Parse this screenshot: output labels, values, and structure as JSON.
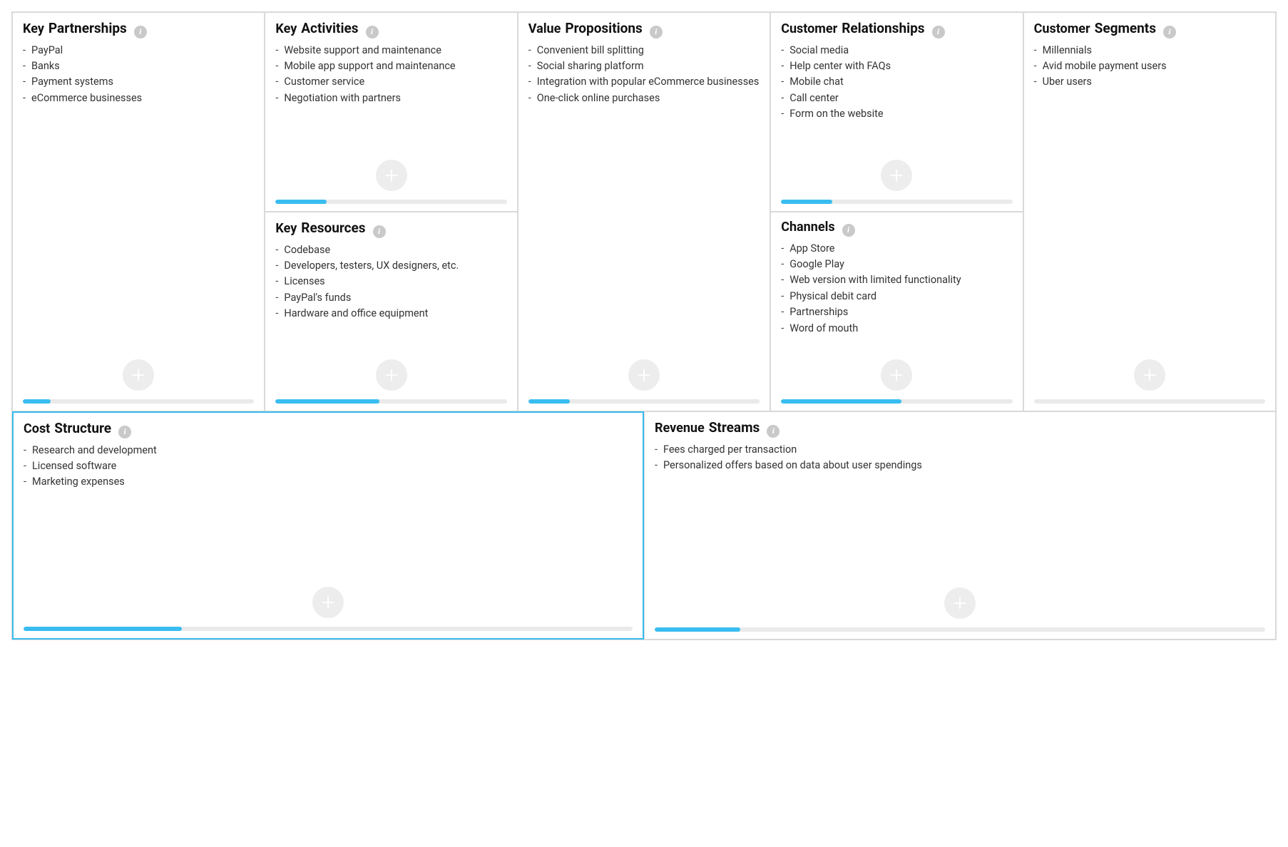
{
  "blocks": {
    "kp": {
      "title_a": "Key",
      "title_b": "Partnerships",
      "items": [
        "PayPal",
        "Banks",
        "Payment systems",
        "eCommerce businesses"
      ],
      "progress": 12,
      "selected": false
    },
    "ka": {
      "title_a": "Key",
      "title_b": "Activities",
      "items": [
        "Website support and maintenance",
        "Mobile app support and maintenance",
        "Customer service",
        "Negotiation with partners"
      ],
      "progress": 22,
      "selected": false
    },
    "kr": {
      "title_a": "Key",
      "title_b": "Resources",
      "items": [
        "Codebase",
        "Developers, testers, UX designers, etc.",
        "Licenses",
        "PayPal's funds",
        "Hardware and office equipment"
      ],
      "progress": 45,
      "selected": false
    },
    "vp": {
      "title_a": "Value",
      "title_b": "Propositions",
      "items": [
        "Convenient bill splitting",
        "Social sharing platform",
        "Integration with popular eCommerce businesses",
        "One-click online purchases"
      ],
      "progress": 18,
      "selected": false
    },
    "cr": {
      "title_a": "Customer",
      "title_b": "Relationships",
      "items": [
        "Social media",
        "Help center with FAQs",
        "Mobile chat",
        "Call center",
        "Form on the website"
      ],
      "progress": 22,
      "selected": false
    },
    "ch": {
      "title_a": "Channels",
      "title_b": "",
      "items": [
        "App Store",
        "Google Play",
        "Web version with limited functionality",
        "Physical debit card",
        "Partnerships",
        "Word of mouth"
      ],
      "progress": 52,
      "selected": false
    },
    "cs": {
      "title_a": "Customer",
      "title_b": "Segments",
      "items": [
        "Millennials",
        "Avid mobile payment users",
        "Uber users"
      ],
      "progress": 0,
      "selected": false
    },
    "co": {
      "title_a": "Cost",
      "title_b": "Structure",
      "items": [
        "Research and development",
        "Licensed software",
        "Marketing expenses"
      ],
      "progress": 26,
      "selected": true
    },
    "rs": {
      "title_a": "Revenue",
      "title_b": "Streams",
      "items": [
        "Fees charged per transaction",
        "Personalized offers based on data about user spendings"
      ],
      "progress": 14,
      "selected": false
    }
  }
}
